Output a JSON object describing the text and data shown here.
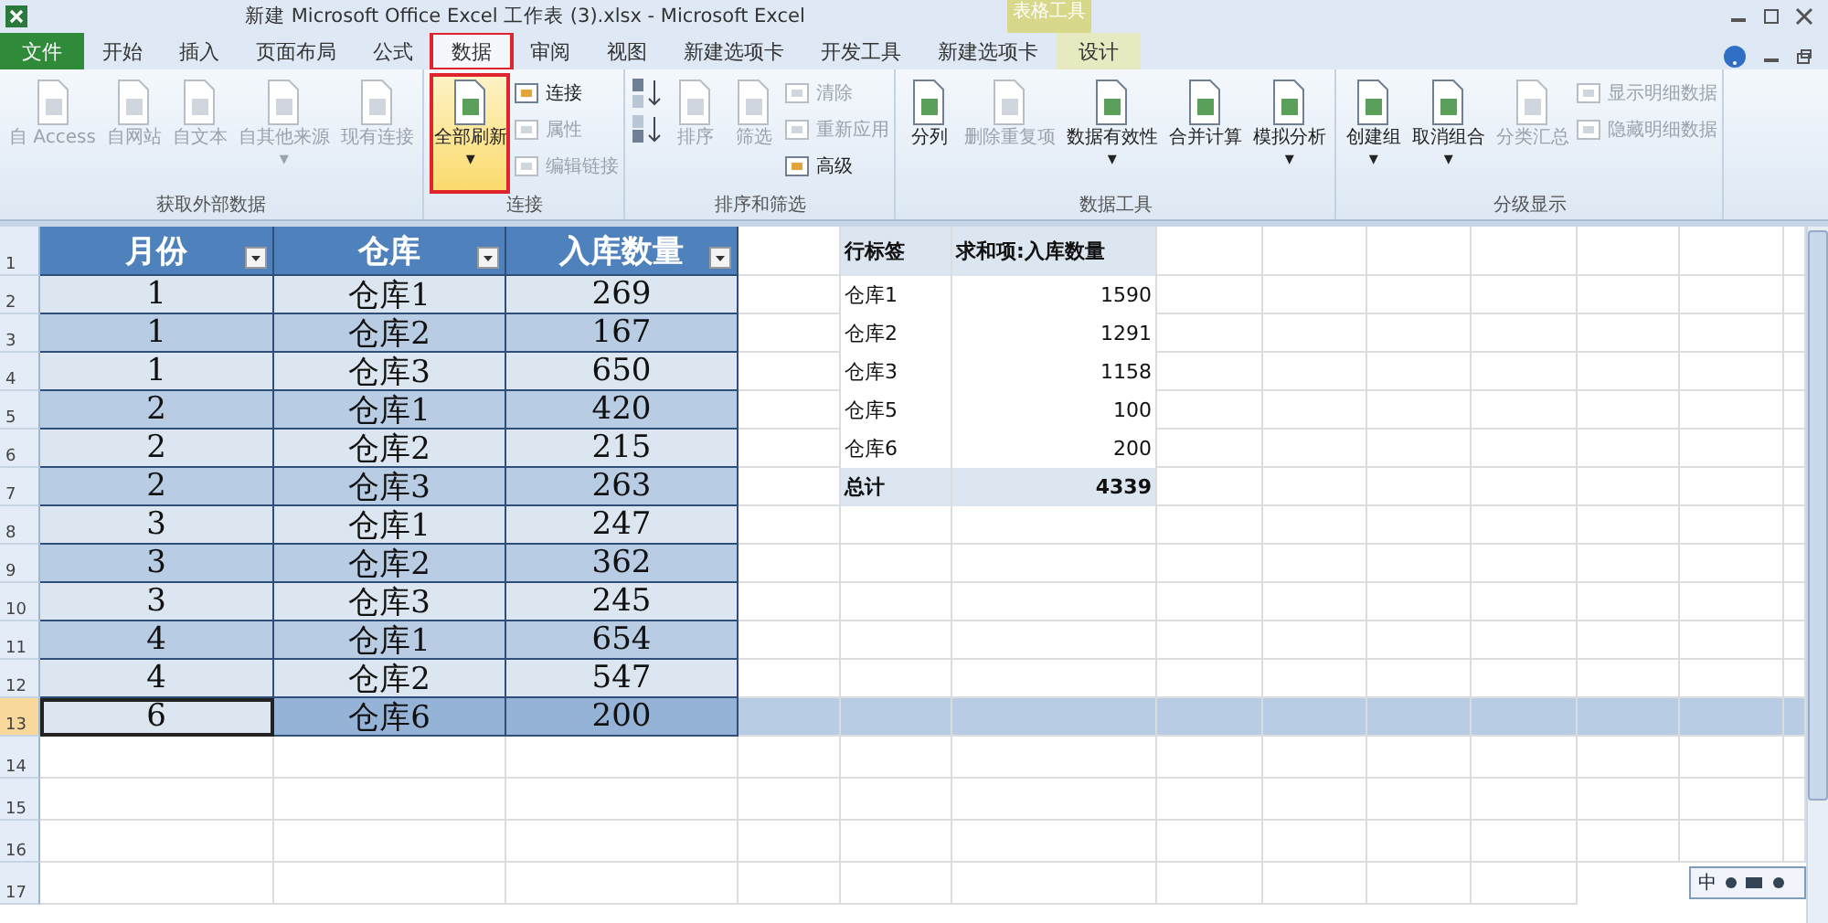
{
  "window": {
    "title": "新建 Microsoft Office Excel 工作表 (3).xlsx  -  Microsoft Excel",
    "context_label": "表格工具"
  },
  "tabs": [
    {
      "label": "文件",
      "kind": "file",
      "selected": false,
      "highlighted": false
    },
    {
      "label": "开始",
      "kind": "tab",
      "selected": false,
      "highlighted": false
    },
    {
      "label": "插入",
      "kind": "tab",
      "selected": false,
      "highlighted": false
    },
    {
      "label": "页面布局",
      "kind": "tab",
      "selected": false,
      "highlighted": false
    },
    {
      "label": "公式",
      "kind": "tab",
      "selected": false,
      "highlighted": false
    },
    {
      "label": "数据",
      "kind": "tab",
      "selected": true,
      "highlighted": true
    },
    {
      "label": "审阅",
      "kind": "tab",
      "selected": false,
      "highlighted": false
    },
    {
      "label": "视图",
      "kind": "tab",
      "selected": false,
      "highlighted": false
    },
    {
      "label": "新建选项卡",
      "kind": "tab",
      "selected": false,
      "highlighted": false
    },
    {
      "label": "开发工具",
      "kind": "tab",
      "selected": false,
      "highlighted": false
    },
    {
      "label": "新建选项卡",
      "kind": "tab",
      "selected": false,
      "highlighted": false
    },
    {
      "label": "设计",
      "kind": "context",
      "selected": false,
      "highlighted": false
    }
  ],
  "ribbon_groups": [
    {
      "label": "获取外部数据",
      "items": [
        {
          "kind": "large",
          "label": "自 Access",
          "disabled": true,
          "highlighted": false
        },
        {
          "kind": "large",
          "label": "自网站",
          "disabled": true,
          "highlighted": false
        },
        {
          "kind": "large",
          "label": "自文本",
          "disabled": true,
          "highlighted": false
        },
        {
          "kind": "large",
          "label": "自其他来源",
          "caret": "▾",
          "disabled": true,
          "highlighted": false
        },
        {
          "kind": "large",
          "label": "现有连接",
          "disabled": true,
          "highlighted": false
        }
      ]
    },
    {
      "label": "连接",
      "items": [
        {
          "kind": "large",
          "label": "全部刷新",
          "caret": "▾",
          "disabled": false,
          "highlighted": true
        },
        {
          "kind": "stack",
          "items": [
            {
              "label": "连接",
              "disabled": false
            },
            {
              "label": "属性",
              "disabled": true
            },
            {
              "label": "编辑链接",
              "disabled": true
            }
          ]
        }
      ]
    },
    {
      "label": "排序和筛选",
      "items": [
        {
          "kind": "sort_pair",
          "items": [
            {
              "kind": "ascending"
            },
            {
              "kind": "descending"
            }
          ]
        },
        {
          "kind": "large",
          "label": "排序",
          "disabled": true,
          "highlighted": false
        },
        {
          "kind": "large",
          "label": "筛选",
          "disabled": true,
          "highlighted": false
        },
        {
          "kind": "stack",
          "items": [
            {
              "label": "清除",
              "disabled": true
            },
            {
              "label": "重新应用",
              "disabled": true
            },
            {
              "label": "高级",
              "disabled": false
            }
          ]
        }
      ]
    },
    {
      "label": "数据工具",
      "items": [
        {
          "kind": "large",
          "label": "分列",
          "disabled": false,
          "highlighted": false
        },
        {
          "kind": "large",
          "label": "删除重复项",
          "disabled": true,
          "highlighted": false
        },
        {
          "kind": "large",
          "label": "数据有效性",
          "caret": "▾",
          "disabled": false,
          "highlighted": false
        },
        {
          "kind": "large",
          "label": "合并计算",
          "disabled": false,
          "highlighted": false
        },
        {
          "kind": "large",
          "label": "模拟分析",
          "caret": "▾",
          "disabled": false,
          "highlighted": false
        }
      ]
    },
    {
      "label": "分级显示",
      "items": [
        {
          "kind": "large",
          "label": "创建组",
          "caret": "▾",
          "disabled": false,
          "highlighted": false
        },
        {
          "kind": "large",
          "label": "取消组合",
          "caret": "▾",
          "disabled": false,
          "highlighted": false
        },
        {
          "kind": "large",
          "label": "分类汇总",
          "disabled": true,
          "highlighted": false
        },
        {
          "kind": "stack",
          "items": [
            {
              "label": "显示明细数据",
              "disabled": true
            },
            {
              "label": "隐藏明细数据",
              "disabled": true
            }
          ]
        }
      ]
    }
  ],
  "table": {
    "columns": [
      "月份",
      "仓库",
      "入库数量"
    ],
    "rows": [
      {
        "cells": [
          "1",
          "仓库1",
          "269"
        ],
        "selected": false
      },
      {
        "cells": [
          "1",
          "仓库2",
          "167"
        ],
        "selected": false
      },
      {
        "cells": [
          "1",
          "仓库3",
          "650"
        ],
        "selected": false
      },
      {
        "cells": [
          "2",
          "仓库1",
          "420"
        ],
        "selected": false
      },
      {
        "cells": [
          "2",
          "仓库2",
          "215"
        ],
        "selected": false
      },
      {
        "cells": [
          "2",
          "仓库3",
          "263"
        ],
        "selected": false
      },
      {
        "cells": [
          "3",
          "仓库1",
          "247"
        ],
        "selected": false
      },
      {
        "cells": [
          "3",
          "仓库2",
          "362"
        ],
        "selected": false
      },
      {
        "cells": [
          "3",
          "仓库3",
          "245"
        ],
        "selected": false
      },
      {
        "cells": [
          "4",
          "仓库1",
          "654"
        ],
        "selected": false
      },
      {
        "cells": [
          "4",
          "仓库2",
          "547"
        ],
        "selected": false
      },
      {
        "cells": [
          "6",
          "仓库6",
          "200"
        ],
        "selected": true
      }
    ]
  },
  "pivot": {
    "columns": [
      "行标签",
      "求和项:入库数量"
    ],
    "rows": [
      {
        "label": "仓库1",
        "value": "1590"
      },
      {
        "label": "仓库2",
        "value": "1291"
      },
      {
        "label": "仓库3",
        "value": "1158"
      },
      {
        "label": "仓库5",
        "value": "100"
      },
      {
        "label": "仓库6",
        "value": "200"
      }
    ],
    "total": {
      "label": "总计",
      "value": "4339"
    }
  },
  "row_numbers": [
    "1",
    "2",
    "3",
    "4",
    "5",
    "6",
    "7",
    "8",
    "9",
    "10",
    "11",
    "12",
    "13",
    "14",
    "15",
    "16",
    "17"
  ],
  "ime_bar": {
    "mode": "中"
  }
}
